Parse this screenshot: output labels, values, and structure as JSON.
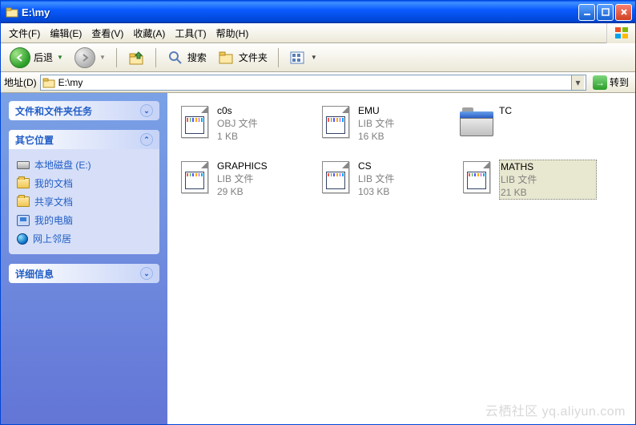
{
  "window_title": "E:\\my",
  "menu": {
    "file": "文件(F)",
    "edit": "编辑(E)",
    "view": "查看(V)",
    "favorites": "收藏(A)",
    "tools": "工具(T)",
    "help": "帮助(H)"
  },
  "toolbar": {
    "back": "后退",
    "search": "搜索",
    "folders": "文件夹"
  },
  "addressbar": {
    "label": "地址(D)",
    "value": "E:\\my",
    "go": "转到"
  },
  "sidebar": {
    "panel1_title": "文件和文件夹任务",
    "panel2_title": "其它位置",
    "panel3_title": "详细信息",
    "places": [
      {
        "label": "本地磁盘 (E:)",
        "icon": "disk"
      },
      {
        "label": "我的文档",
        "icon": "folder"
      },
      {
        "label": "共享文档",
        "icon": "folder"
      },
      {
        "label": "我的电脑",
        "icon": "mypc"
      },
      {
        "label": "网上邻居",
        "icon": "globe"
      }
    ]
  },
  "files": [
    {
      "name": "c0s",
      "type": "OBJ 文件",
      "size": "1 KB",
      "icon": "obj",
      "selected": false
    },
    {
      "name": "EMU",
      "type": "LIB 文件",
      "size": "16 KB",
      "icon": "lib",
      "selected": false
    },
    {
      "name": "TC",
      "type": "",
      "size": "",
      "icon": "folder",
      "selected": false
    },
    {
      "name": "GRAPHICS",
      "type": "LIB 文件",
      "size": "29 KB",
      "icon": "lib",
      "selected": false
    },
    {
      "name": "CS",
      "type": "LIB 文件",
      "size": "103 KB",
      "icon": "lib",
      "selected": false
    },
    {
      "name": "MATHS",
      "type": "LIB 文件",
      "size": "21 KB",
      "icon": "lib",
      "selected": true
    }
  ],
  "watermark": "云栖社区 yq.aliyun.com"
}
